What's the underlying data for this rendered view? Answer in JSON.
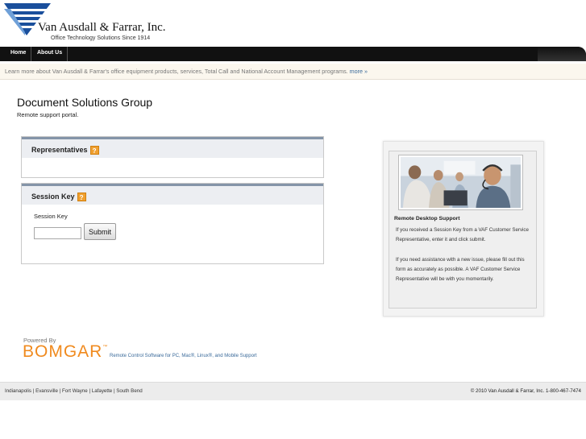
{
  "header": {
    "company_name": "Van Ausdall & Farrar, Inc.",
    "tagline": "Office Technology Solutions Since 1914"
  },
  "nav": {
    "items": [
      {
        "label": "Home"
      },
      {
        "label": "About Us"
      }
    ]
  },
  "infobar": {
    "text": "Learn more about Van Ausdall & Farrar's office equipment products, services, Total Call and National Account Management programs.",
    "more_link": "more »"
  },
  "page": {
    "title": "Document Solutions Group",
    "subtitle": "Remote support portal."
  },
  "representatives": {
    "title": "Representatives",
    "help_icon": "?"
  },
  "session_key": {
    "title": "Session Key",
    "help_icon": "?",
    "field_label": "Session Key",
    "value": "",
    "submit_label": "Submit"
  },
  "side_card": {
    "title": "Remote Desktop Support",
    "text_1": "If you received a Session Key from a VAF Customer Service Representative, enter it and click submit.",
    "text_2": "If you need assistance with a new issue, please fill out this form as accurately as possible. A VAF Customer Service Representative will be with you momentarily."
  },
  "bomgar": {
    "powered_by": "Powered By",
    "brand": "BOMGAR",
    "trademark": "™",
    "link_text": "Remote Control Software for PC, Mac®, Linux®, and Mobile Support"
  },
  "footer": {
    "locations": [
      "Indianapolis",
      "Evansville",
      "Fort Wayne",
      "Lafayette",
      "South Bend"
    ],
    "separator": " | ",
    "copyright": "© 2010 Van Ausdall & Farrar, Inc. 1-800-467-7474"
  },
  "colors": {
    "nav_bg": "#111111",
    "logo_blue": "#1a4f9c",
    "bomgar_orange": "#f08a1e",
    "link_blue": "#3a6a9a",
    "panel_header": "#eceef2"
  }
}
